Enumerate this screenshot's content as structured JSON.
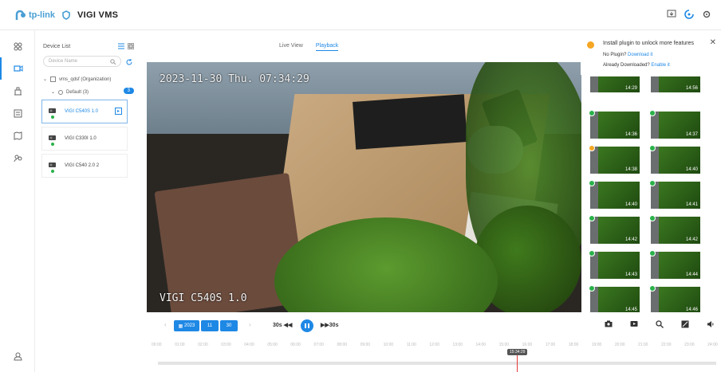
{
  "header": {
    "brand": "tp-link",
    "product": "VIGI VMS"
  },
  "device_list": {
    "title": "Device List",
    "search_placeholder": "Device Name",
    "organization": "vms_qdsf (Organization)",
    "group": "Default (3)",
    "group_count": "3",
    "cameras": [
      {
        "name": "VIGI C540S 1.0",
        "status": "online",
        "selected": true
      },
      {
        "name": "VIGI C330I 1.0",
        "status": "online",
        "selected": false
      },
      {
        "name": "VIGI C540 2.0 2",
        "status": "online",
        "selected": false
      }
    ]
  },
  "tabs": {
    "live_view": "Live View",
    "playback": "Playback",
    "active": "Playback"
  },
  "video": {
    "timestamp": "2023-11-30 Thu. 07:34:29",
    "camera_label": "VIGI C540S 1.0"
  },
  "notice": {
    "message": "Install plugin to unlock more features",
    "no_plugin": "No Plugin?",
    "download": "Download it",
    "already": "Already Downloaded?",
    "enable": "Enable it"
  },
  "thumbnails": [
    {
      "time": "14:29",
      "status": "none"
    },
    {
      "time": "14:56",
      "status": "none"
    },
    {
      "time": "14:36",
      "status": "ok"
    },
    {
      "time": "14:37",
      "status": "ok"
    },
    {
      "time": "14:38",
      "status": "warn"
    },
    {
      "time": "14:40",
      "status": "ok"
    },
    {
      "time": "14:40",
      "status": "ok"
    },
    {
      "time": "14:41",
      "status": "ok"
    },
    {
      "time": "14:42",
      "status": "ok"
    },
    {
      "time": "14:42",
      "status": "ok"
    },
    {
      "time": "14:43",
      "status": "ok"
    },
    {
      "time": "14:44",
      "status": "ok"
    },
    {
      "time": "14:45",
      "status": "ok"
    },
    {
      "time": "14:46",
      "status": "ok"
    }
  ],
  "controls": {
    "year": "2023",
    "month": "11",
    "day": "30",
    "rewind": "30s",
    "forward": "30s"
  },
  "timeline": {
    "ticks": [
      "00:00",
      "01:00",
      "02:00",
      "03:00",
      "04:00",
      "05:00",
      "06:00",
      "07:00",
      "08:00",
      "09:00",
      "10:00",
      "11:00",
      "12:00",
      "13:00",
      "14:00",
      "15:00",
      "16:00",
      "17:00",
      "18:00",
      "19:00",
      "20:00",
      "21:00",
      "22:00",
      "23:00",
      "24:00"
    ],
    "cursor_time": "15:34:29"
  },
  "colors": {
    "accent": "#1e88e5",
    "online": "#2ab24a",
    "warning": "#f5a623",
    "cursor": "#e53935"
  }
}
